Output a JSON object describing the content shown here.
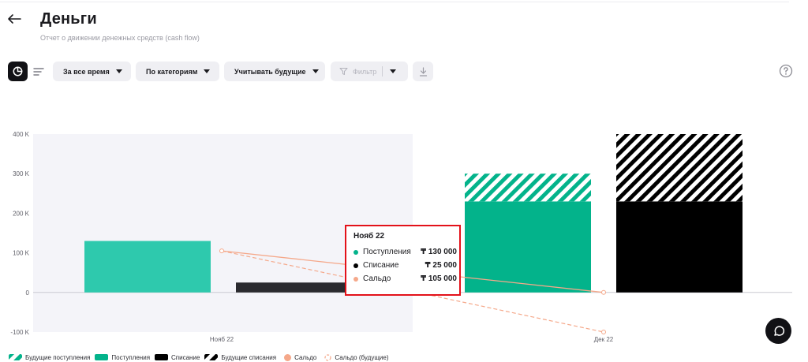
{
  "page": {
    "title": "Деньги",
    "subtitle": "Отчет о движении денежных средств (cash flow)"
  },
  "toolbar": {
    "period": "За все время",
    "grouping": "По категориям",
    "future": "Учитывать будущие",
    "filter_placeholder": "Фильтр"
  },
  "icons": [
    "back-arrow-icon",
    "pie-chart-icon",
    "sort-lines-icon",
    "funnel-icon",
    "download-icon",
    "help-icon",
    "chat-icon"
  ],
  "colors": {
    "income": "#03b38b",
    "income_current": "#2ec9ad",
    "expense": "#000000",
    "expense_current": "#2a2a2f",
    "balance": "#f5a88a",
    "highlight": "#e3111a"
  },
  "tooltip": {
    "title": "Нояб 22",
    "rows": [
      {
        "label": "Поступления",
        "value": "₸ 130 000",
        "color": "#03b38b"
      },
      {
        "label": "Списание",
        "value": "₸ 25 000",
        "color": "#000000"
      },
      {
        "label": "Сальдо",
        "value": "₸ 105 000",
        "color": "#f5a88a"
      }
    ]
  },
  "chart_data": {
    "type": "bar",
    "categories": [
      "Нояб 22",
      "Дек 22"
    ],
    "y_ticks": [
      -100000,
      0,
      100000,
      200000,
      300000,
      400000
    ],
    "y_tick_labels": [
      "-100 K",
      "0",
      "100 K",
      "200 K",
      "300 K",
      "400 K"
    ],
    "ylim": [
      -100000,
      400000
    ],
    "highlighted_category": "Нояб 22",
    "series": [
      {
        "name": "Будущие поступления",
        "kind": "stacked-hatched",
        "values": [
          0,
          70000
        ]
      },
      {
        "name": "Поступления",
        "kind": "bar",
        "values": [
          130000,
          230000
        ]
      },
      {
        "name": "Списание",
        "kind": "bar",
        "values": [
          25000,
          230000
        ]
      },
      {
        "name": "Будущие списания",
        "kind": "stacked-hatched",
        "values": [
          0,
          170000
        ]
      },
      {
        "name": "Сальдо",
        "kind": "line",
        "values": [
          105000,
          0
        ]
      },
      {
        "name": "Сальдо (будущие)",
        "kind": "dashed-line",
        "values": [
          105000,
          -100000
        ]
      }
    ],
    "legend": [
      {
        "label": "Будущие поступления",
        "swatch": "hatch-income"
      },
      {
        "label": "Поступления",
        "swatch": "solid-income"
      },
      {
        "label": "Списание",
        "swatch": "solid-expense"
      },
      {
        "label": "Будущие списания",
        "swatch": "hatch-expense"
      },
      {
        "label": "Сальдо",
        "swatch": "dot-balance"
      },
      {
        "label": "Сальдо (будущие)",
        "swatch": "ring-balance"
      }
    ],
    "legend_position": "bottom-left",
    "grid": false
  }
}
